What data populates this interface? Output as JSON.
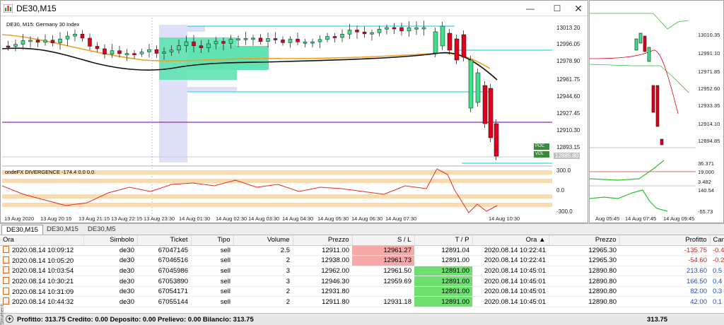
{
  "window": {
    "title": "DE30,M15"
  },
  "chart": {
    "info_label": "DE30, M15:  Germany 30 Index",
    "price_labels": [
      "13013.20",
      "12996.05",
      "12978.90",
      "12961.75",
      "12944.60",
      "12927.45",
      "12910.30",
      "12893.15"
    ],
    "current_price": "12885.80",
    "poc_label": "POC",
    "vol_label": "VOL",
    "indicator_label": "ondeFX DIVERGENCE -174.4 0.0 0.0",
    "indicator_levels": [
      "300.0",
      "0.0",
      "-300.0"
    ],
    "time_labels": [
      "13 Aug 2020",
      "13 Aug 20:15",
      "13 Aug 21:15",
      "13 Aug 22:15",
      "13 Aug 23:30",
      "14 Aug 01:30",
      "14 Aug 02:30",
      "14 Aug 03:30",
      "14 Aug 04:30",
      "14 Aug 05:30",
      "14 Aug 06:30",
      "14 Aug 07:30",
      "14 Aug 10:30"
    ],
    "colors": {
      "bull": "#3fe08a",
      "bear": "#e0001b",
      "cyan": "#00c8e8",
      "purple": "#a020c0",
      "orange": "#f0a020",
      "ma": "#111111",
      "band": "#f8dcb0"
    }
  },
  "side_chart": {
    "price_labels": [
      "13010.35",
      "12991.10",
      "12971.85",
      "12952.60",
      "12933.35",
      "12914.10",
      "12894.85"
    ],
    "ind1_labels": [
      "36.371",
      "19.000",
      "3.482"
    ],
    "ind2_labels": [
      "140.54",
      "-55.73"
    ],
    "time_labels": [
      "Aug 05:45",
      "14 Aug 07:45",
      "14 Aug 09:45"
    ]
  },
  "chart_tabs": [
    "DE30,M15",
    "DE30,M15",
    "DE30,M5"
  ],
  "table": {
    "columns": [
      "Ora",
      "Simbolo",
      "Ticket",
      "Tipo",
      "Volume",
      "Prezzo",
      "S / L",
      "T / P",
      "Ora",
      "Prezzo",
      "Profitto",
      "Cam"
    ],
    "rows": [
      {
        "ora": "2020.08.14 10:09:12",
        "simbolo": "de30",
        "ticket": "67047145",
        "tipo": "sell",
        "volume": "2.5",
        "prezzo": "12911.00",
        "sl": "12961.27",
        "tp": "12891.04",
        "ora2": "2020.08.14 10:22:41",
        "prezzo2": "12965.30",
        "profitto": "-135.75",
        "cam": "-0.4"
      },
      {
        "ora": "2020.08.14 10:05:20",
        "simbolo": "de30",
        "ticket": "67046516",
        "tipo": "sell",
        "volume": "2",
        "prezzo": "12938.00",
        "sl": "12961.73",
        "tp": "12891.00",
        "ora2": "2020.08.14 10:22:41",
        "prezzo2": "12965.30",
        "profitto": "-54.60",
        "cam": "-0.2"
      },
      {
        "ora": "2020.08.14 10:03:54",
        "simbolo": "de30",
        "ticket": "67045986",
        "tipo": "sell",
        "volume": "3",
        "prezzo": "12962.00",
        "sl": "12961.50",
        "tp": "12891.00",
        "ora2": "2020.08.14 10:45:01",
        "prezzo2": "12890.80",
        "profitto": "213.60",
        "cam": "0.5"
      },
      {
        "ora": "2020.08.14 10:30:21",
        "simbolo": "de30",
        "ticket": "67053890",
        "tipo": "sell",
        "volume": "3",
        "prezzo": "12946.30",
        "sl": "12959.69",
        "tp": "12891.00",
        "ora2": "2020.08.14 10:45:01",
        "prezzo2": "12890.80",
        "profitto": "166.50",
        "cam": "0.4"
      },
      {
        "ora": "2020.08.14 10:31:09",
        "simbolo": "de30",
        "ticket": "67054171",
        "tipo": "sell",
        "volume": "2",
        "prezzo": "12931.80",
        "sl": "",
        "tp": "12891.00",
        "ora2": "2020.08.14 10:45:01",
        "prezzo2": "12890.80",
        "profitto": "82.00",
        "cam": "0.3"
      },
      {
        "ora": "2020.08.14 10:44:32",
        "simbolo": "de30",
        "ticket": "67055144",
        "tipo": "sell",
        "volume": "2",
        "prezzo": "12911.80",
        "sl": "12931.18",
        "tp": "12891.00",
        "ora2": "2020.08.14 10:45:01",
        "prezzo2": "12890.80",
        "profitto": "42.00",
        "cam": "0.1"
      }
    ]
  },
  "summary": {
    "text": "Profitto: 313.75  Credito: 0.00  Deposito: 0.00  Prelievo: 0.00  Bilancio: 313.75",
    "total": "313.75"
  },
  "side_tab_label": "Strumenti"
}
